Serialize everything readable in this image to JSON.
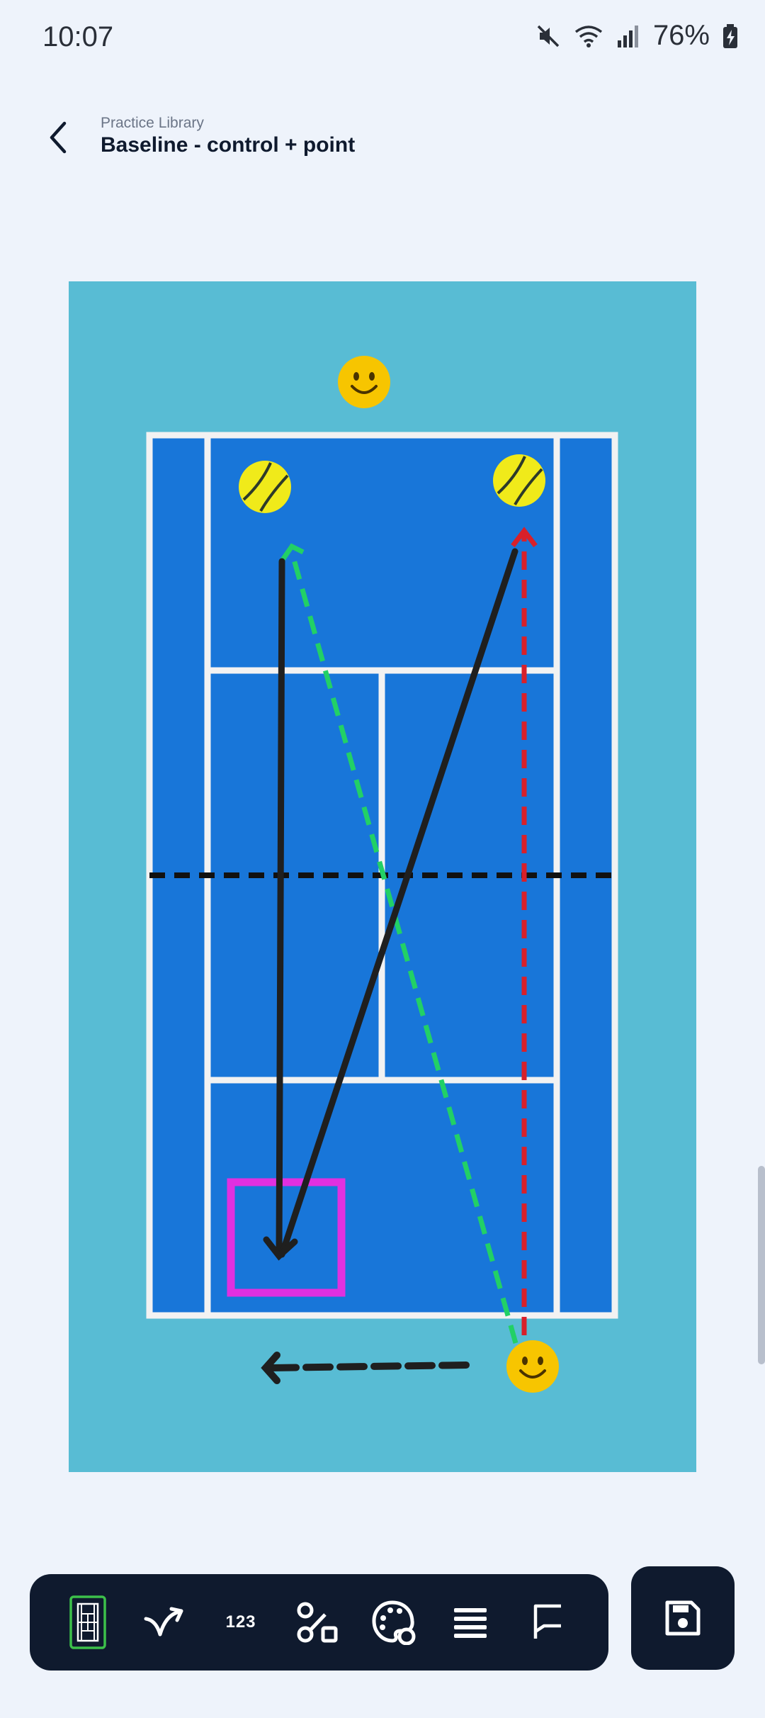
{
  "status_bar": {
    "time": "10:07",
    "battery_percent": "76%",
    "icons": [
      "mute-icon",
      "wifi-icon",
      "signal-icon",
      "battery-charging-icon"
    ]
  },
  "header": {
    "subtitle": "Practice Library",
    "title": "Baseline - control + point"
  },
  "court": {
    "colors": {
      "outer": "#58bcd4",
      "inner": "#1876d9",
      "lines": "#f2f2f2",
      "net": "#111111",
      "target_box": "#e030e0",
      "path_black": "#1f1f1f",
      "path_green": "#22d066",
      "path_red": "#d8202a",
      "player": "#f7c500",
      "ball": "#f0ea1a"
    },
    "players": [
      "player-top",
      "player-bottom"
    ],
    "balls": [
      "ball-left",
      "ball-right"
    ]
  },
  "toolbar": {
    "tools": [
      {
        "name": "court-tool",
        "icon": "court-icon",
        "active": true
      },
      {
        "name": "path-tool",
        "icon": "curved-arrow-icon"
      },
      {
        "name": "number-tool",
        "label": "123"
      },
      {
        "name": "connect-shape-tool",
        "icon": "connector-icon"
      },
      {
        "name": "color-tool",
        "icon": "palette-icon"
      },
      {
        "name": "layers-tool",
        "icon": "menu-lines-icon"
      },
      {
        "name": "comment-tool",
        "icon": "comment-icon"
      }
    ],
    "active_color": "#3cc04a",
    "save_icon": "save-icon"
  }
}
